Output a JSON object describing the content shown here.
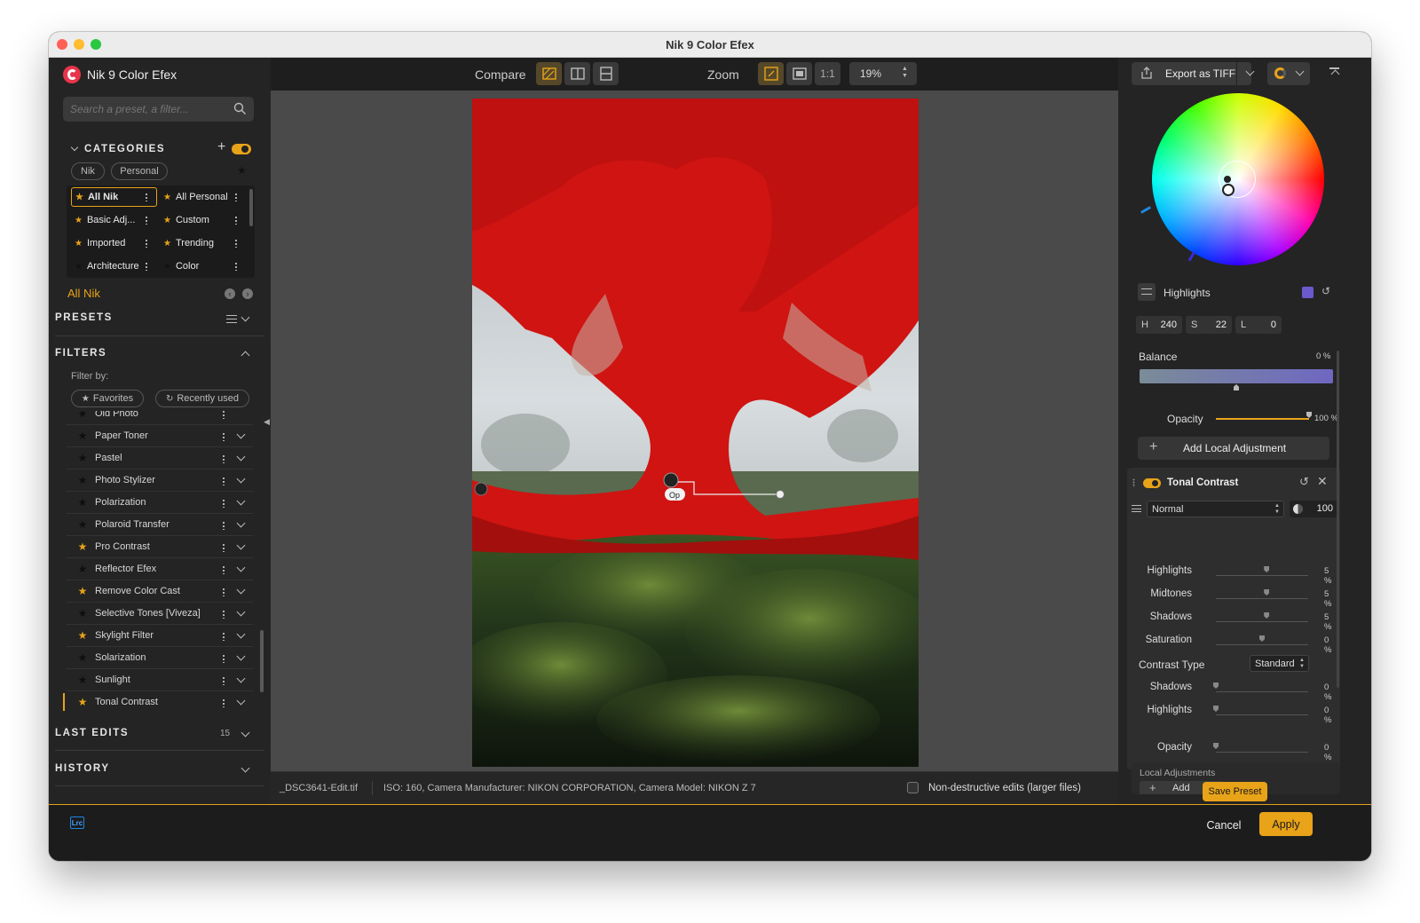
{
  "window": {
    "title": "Nik 9 Color Efex"
  },
  "app": {
    "name": "Nik 9 Color Efex"
  },
  "search": {
    "placeholder": "Search a preset, a filter..."
  },
  "categories": {
    "header": "CATEGORIES",
    "tabs": [
      "Nik",
      "Personal"
    ],
    "grid": [
      {
        "label": "All Nik",
        "starred": true,
        "selected": true
      },
      {
        "label": "All Personal",
        "starred": true
      },
      {
        "label": "Basic Adj...",
        "starred": true
      },
      {
        "label": "Custom",
        "starred": true
      },
      {
        "label": "Imported",
        "starred": true
      },
      {
        "label": "Trending",
        "starred": true
      },
      {
        "label": "Architecture",
        "starred": false
      },
      {
        "label": "Color",
        "starred": false
      }
    ],
    "current": "All Nik"
  },
  "presets": {
    "header": "PRESETS"
  },
  "filters": {
    "header": "FILTERS",
    "filter_by": "Filter by:",
    "chips": [
      "Favorites",
      "Recently used"
    ],
    "partial_item": "Old Photo",
    "items": [
      {
        "name": "Paper Toner",
        "fav": false
      },
      {
        "name": "Pastel",
        "fav": false
      },
      {
        "name": "Photo Stylizer",
        "fav": false
      },
      {
        "name": "Polarization",
        "fav": false
      },
      {
        "name": "Polaroid Transfer",
        "fav": false
      },
      {
        "name": "Pro Contrast",
        "fav": true
      },
      {
        "name": "Reflector Efex",
        "fav": false
      },
      {
        "name": "Remove Color Cast",
        "fav": true
      },
      {
        "name": "Selective Tones [Viveza]",
        "fav": false
      },
      {
        "name": "Skylight Filter",
        "fav": true
      },
      {
        "name": "Solarization",
        "fav": false
      },
      {
        "name": "Sunlight",
        "fav": false
      },
      {
        "name": "Tonal Contrast",
        "fav": true,
        "active": true
      }
    ]
  },
  "last_edits": {
    "header": "LAST EDITS",
    "count": "15"
  },
  "history": {
    "header": "HISTORY"
  },
  "toolbar": {
    "compare_label": "Compare",
    "zoom_label": "Zoom",
    "one_to_one": "1:1",
    "zoom_value": "19%"
  },
  "canvas": {
    "point_label": "Op"
  },
  "statusbar": {
    "filename": "_DSC3641-Edit.tif",
    "meta": "ISO: 160, Camera Manufacturer: NIKON CORPORATION, Camera Model: NIKON Z 7",
    "nondestructive_label": "Non-destructive edits (larger files)"
  },
  "export": {
    "label": "Export as TIFF"
  },
  "color_panel": {
    "mode": "Highlights",
    "swatch_color": "#6a5acd",
    "h_label": "H",
    "h": "240",
    "s_label": "S",
    "s": "22",
    "l_label": "L",
    "l": "0",
    "balance_label": "Balance",
    "balance_value": "0 %",
    "opacity_label": "Opacity",
    "opacity_value": "100 %",
    "opacity_level": 1.0
  },
  "add_local": {
    "label": "Add Local Adjustment"
  },
  "tonal_contrast": {
    "title": "Tonal Contrast",
    "blend_mode": "Normal",
    "opacity": "100",
    "sliders": [
      {
        "label": "Highlights",
        "value": "5 %",
        "level": 0.55
      },
      {
        "label": "Midtones",
        "value": "5 %",
        "level": 0.55
      },
      {
        "label": "Shadows",
        "value": "5 %",
        "level": 0.55
      },
      {
        "label": "Saturation",
        "value": "0 %",
        "level": 0.5
      }
    ],
    "contrast_type_label": "Contrast Type",
    "contrast_type": "Standard",
    "sliders2": [
      {
        "label": "Shadows",
        "value": "0 %",
        "level": 0.0
      },
      {
        "label": "Highlights",
        "value": "0 %",
        "level": 0.0
      }
    ],
    "opacity_row": {
      "label": "Opacity",
      "value": "0 %",
      "level": 0.0
    }
  },
  "local_adjustments": {
    "label": "Local Adjustments",
    "add": "Add"
  },
  "buttons": {
    "save_preset": "Save Preset",
    "cancel": "Cancel",
    "apply": "Apply"
  },
  "lrc_badge": "Lrc",
  "colors": {
    "accent": "#e8a319",
    "panel": "#242424",
    "canvas_bg": "#4a4a4a"
  }
}
